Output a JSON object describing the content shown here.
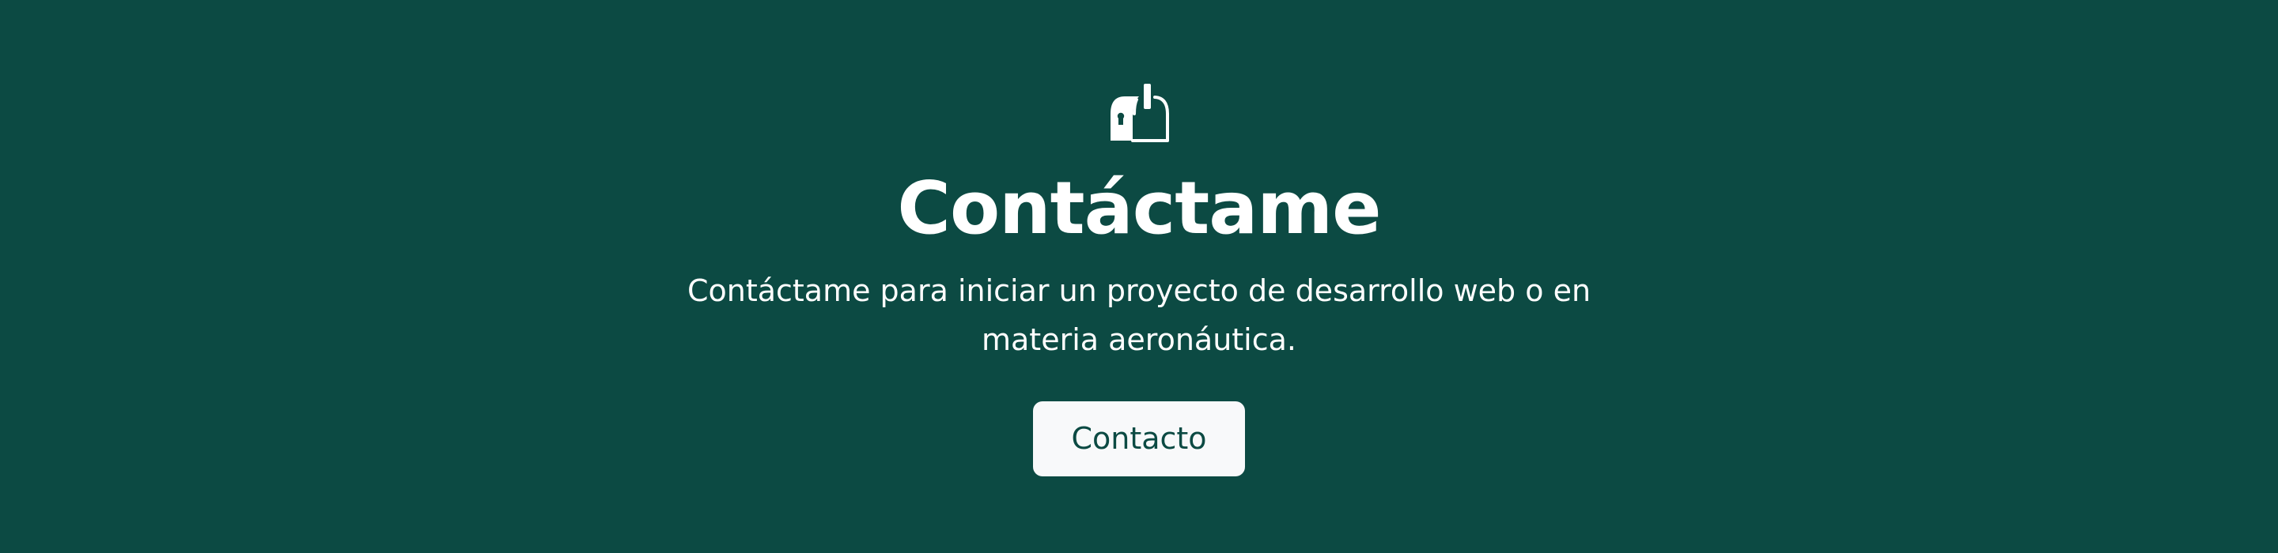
{
  "contact_section": {
    "icon": "mailbox-icon",
    "title": "Contáctame",
    "description": "Contáctame para iniciar un proyecto de desarrollo web o en materia aeronáutica.",
    "button_label": "Contacto"
  },
  "colors": {
    "background": "#0c4a43",
    "text": "#ffffff",
    "button_background": "#f8f9fa",
    "button_text": "#0c4a43"
  }
}
